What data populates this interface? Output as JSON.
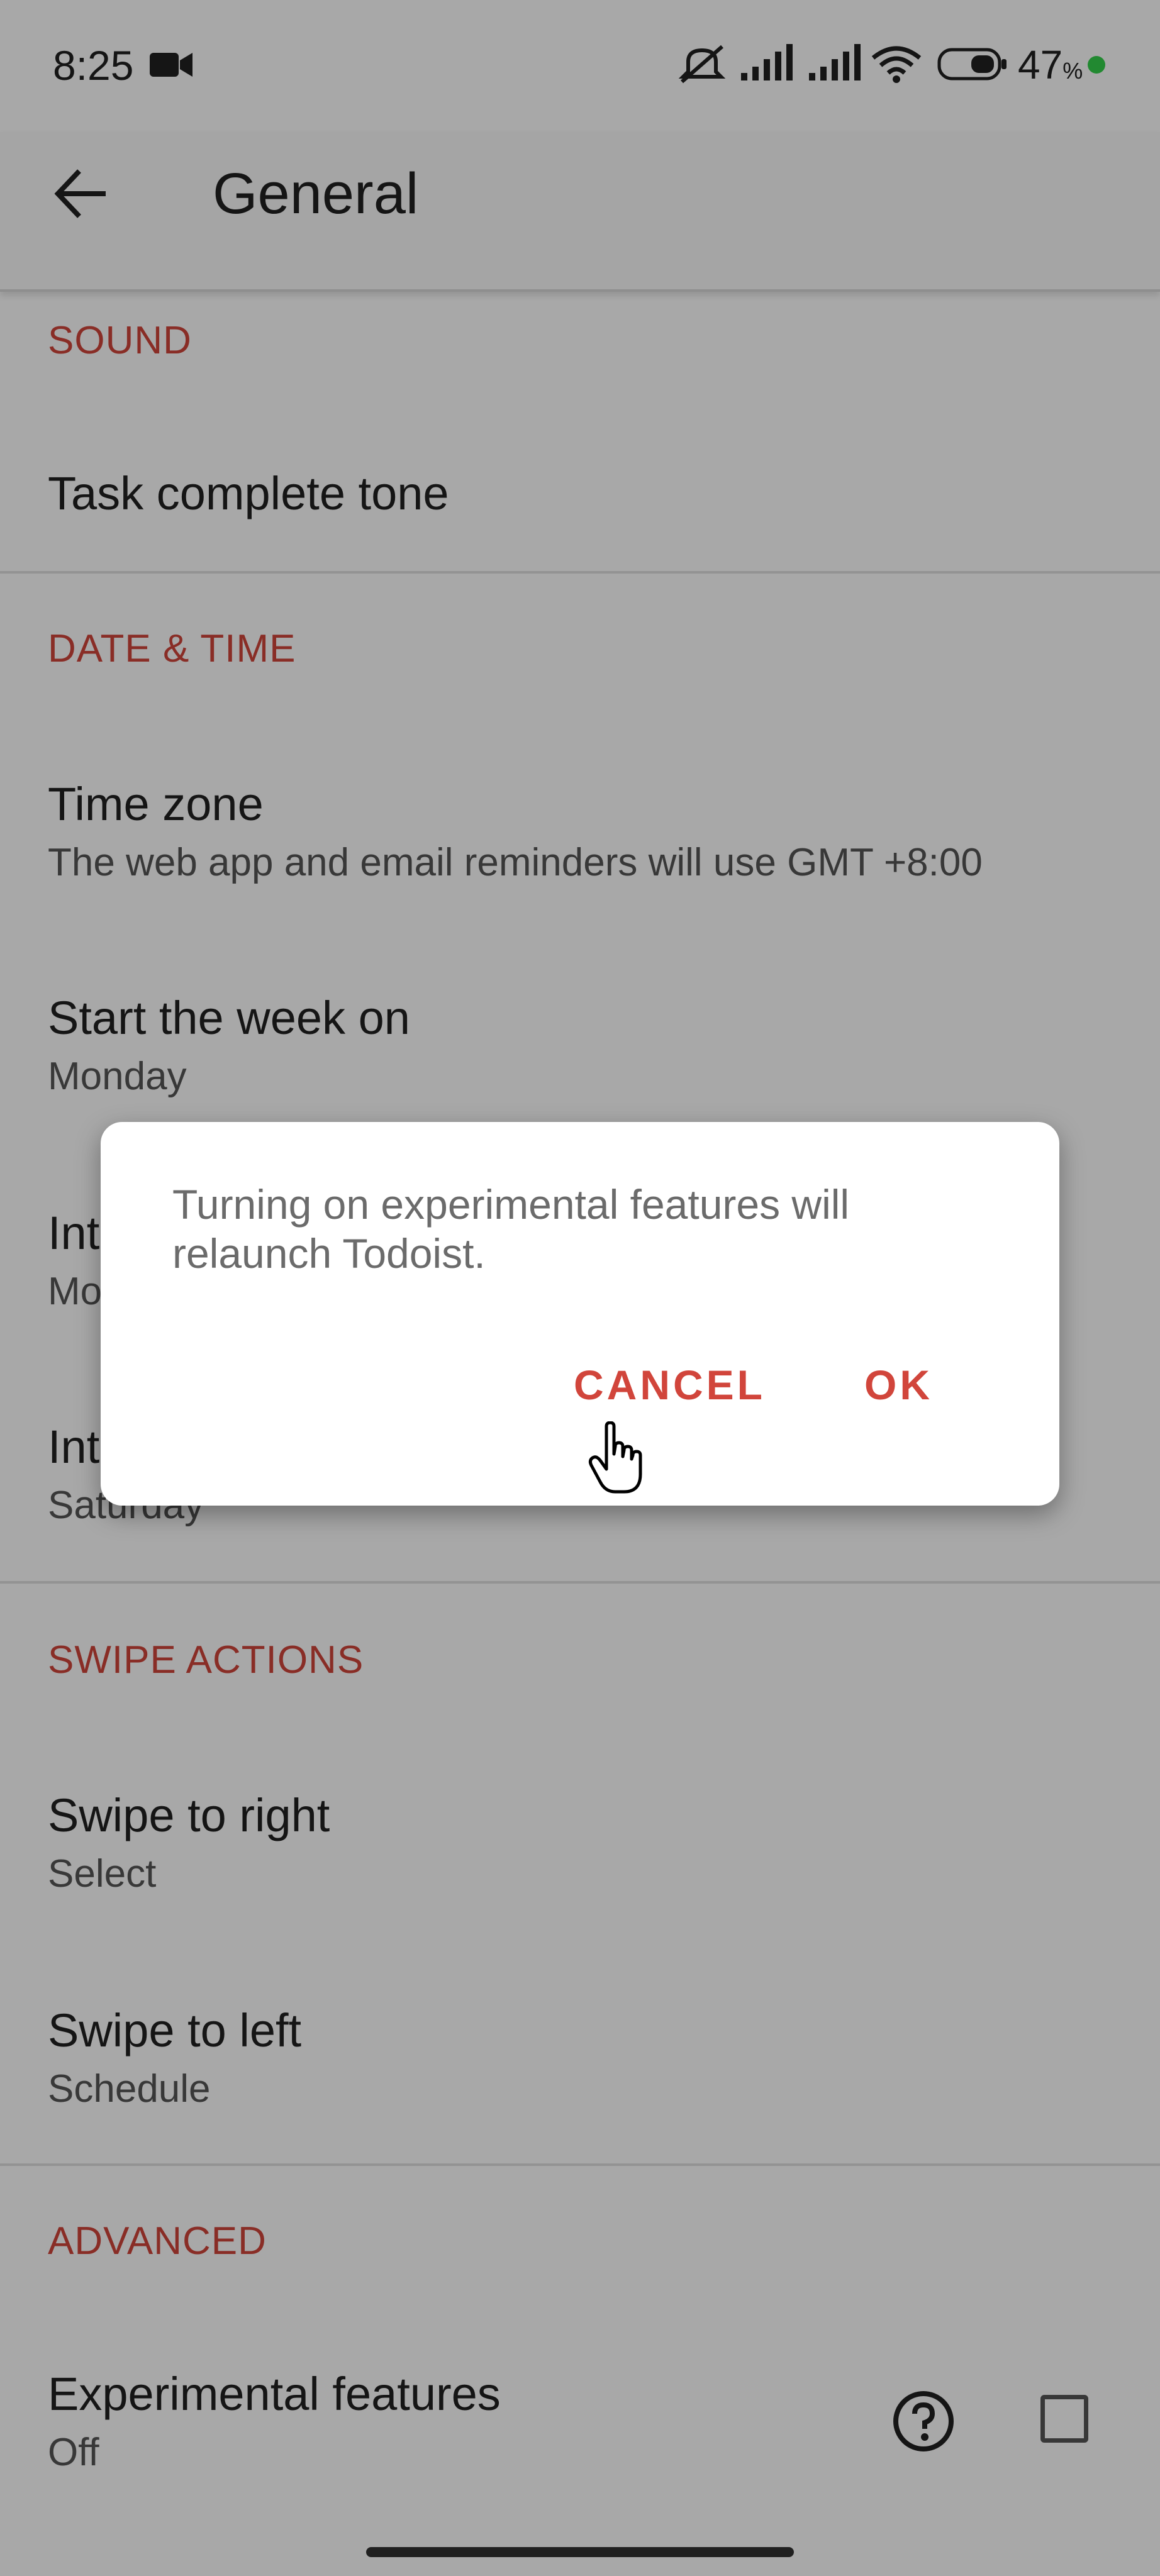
{
  "status_bar": {
    "time": "8:25",
    "battery_percent": "47",
    "battery_symbol": "%"
  },
  "toolbar": {
    "title": "General"
  },
  "sections": {
    "sound": "SOUND",
    "date_time": "DATE & TIME",
    "swipe_actions": "SWIPE ACTIONS",
    "advanced": "ADVANCED"
  },
  "rows": {
    "task_complete_tone": {
      "title": "Task complete tone"
    },
    "time_zone": {
      "title": "Time zone",
      "subtitle": "The web app and email reminders will use GMT +8:00"
    },
    "start_week": {
      "title": "Start the week on",
      "subtitle": "Monday"
    },
    "int_1": {
      "title": "Int",
      "subtitle": "Mo"
    },
    "int_2": {
      "title": "Int",
      "subtitle": "Saturday"
    },
    "swipe_right": {
      "title": "Swipe to right",
      "subtitle": "Select"
    },
    "swipe_left": {
      "title": "Swipe to left",
      "subtitle": "Schedule"
    },
    "experimental": {
      "title": "Experimental features",
      "subtitle": "Off",
      "checked": false
    }
  },
  "dialog": {
    "message": "Turning on experimental features will relaunch Todoist.",
    "cancel_label": "CANCEL",
    "ok_label": "OK"
  },
  "colors": {
    "accent": "#d1453b",
    "background": "#ffffff",
    "scrim": "rgba(0,0,0,0.34)"
  }
}
